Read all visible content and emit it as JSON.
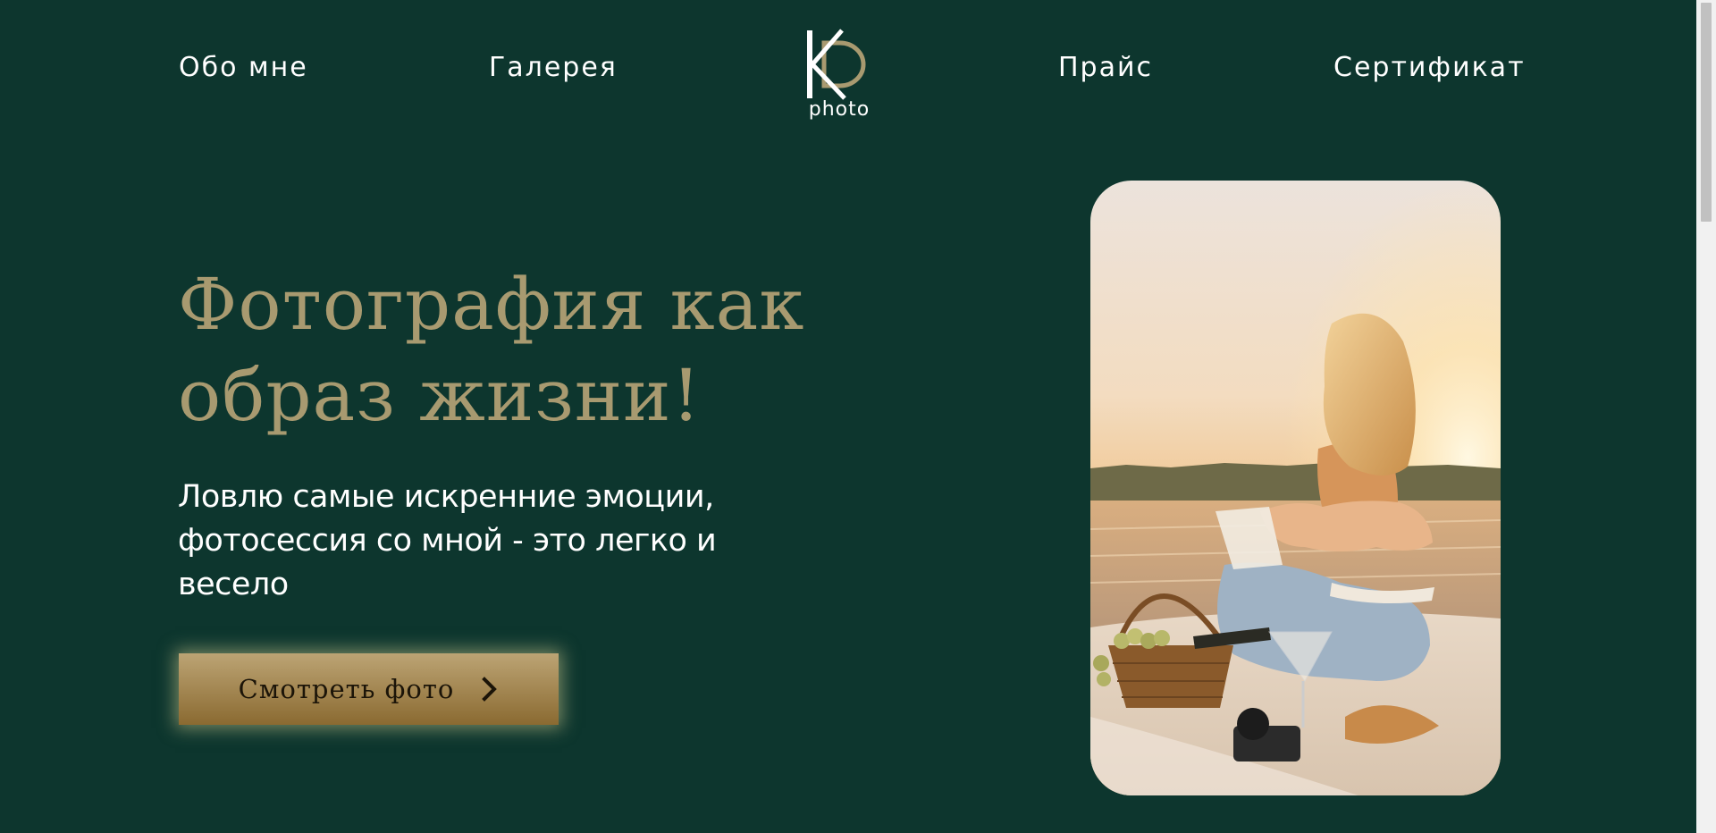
{
  "nav": {
    "items": [
      {
        "label": "Обо мне"
      },
      {
        "label": "Галерея"
      },
      {
        "label": "Прайс"
      },
      {
        "label": "Сертификат"
      }
    ]
  },
  "logo": {
    "text": "photo",
    "letters": "KD"
  },
  "hero": {
    "title": "Фотография как образ жизни!",
    "subtitle": "Ловлю самые искренние эмоции, фотосессия со мной - это легко и весело",
    "button_label": "Смотреть фото",
    "button_icon": "chevron-right-icon",
    "photo_description_icon": "photo"
  },
  "colors": {
    "background": "#0d362e",
    "accent_gold": "#a89a70",
    "button_gold": "#a68a56",
    "text_white": "#ffffff"
  }
}
